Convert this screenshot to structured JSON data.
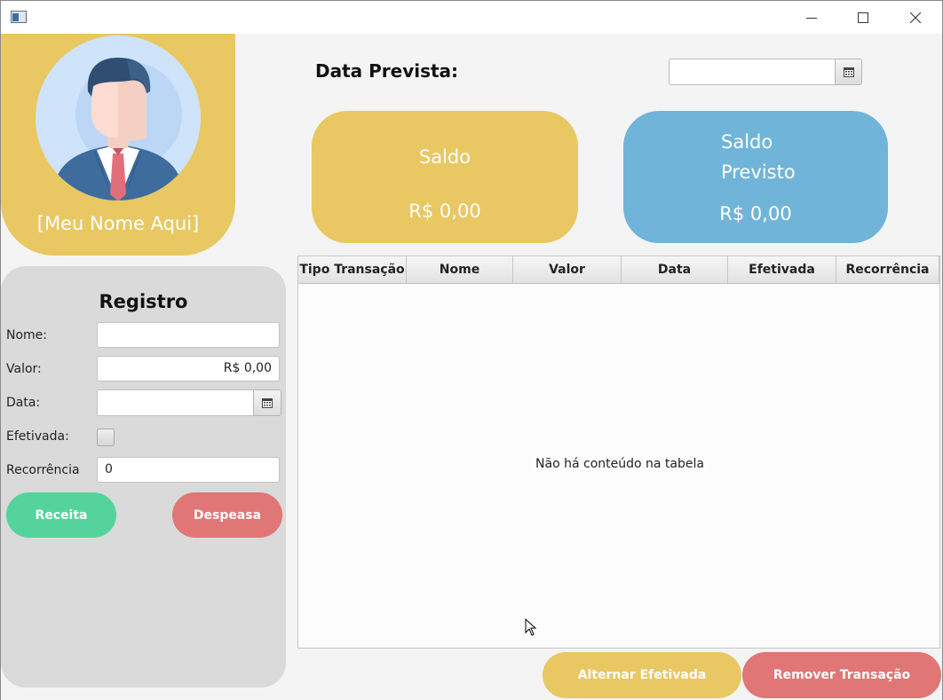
{
  "profile": {
    "name": "[Meu Nome Aqui]"
  },
  "registro": {
    "title": "Registro",
    "nome_label": "Nome:",
    "nome_value": "",
    "valor_label": "Valor:",
    "valor_value": "R$ 0,00",
    "data_label": "Data:",
    "data_value": "",
    "efetivada_label": "Efetivada:",
    "recorrencia_label": "Recorrência",
    "recorrencia_value": "0",
    "receita_label": "Receita",
    "despesa_label": "Despeasa"
  },
  "header": {
    "data_prevista_label": "Data Prevista:",
    "data_prevista_value": ""
  },
  "cards": {
    "saldo_title": "Saldo",
    "saldo_value": "R$ 0,00",
    "previsto_title_line1": "Saldo",
    "previsto_title_line2": "Previsto",
    "previsto_value": "R$ 0,00"
  },
  "table": {
    "columns": [
      "Tipo Transação",
      "Nome",
      "Valor",
      "Data",
      "Efetivada",
      "Recorrência"
    ],
    "empty_message": "Não há conteúdo na tabela"
  },
  "actions": {
    "alternar_label": "Alternar Efetivada",
    "remover_label": "Remover Transação"
  },
  "colors": {
    "yellow": "#e9c762",
    "blue": "#70b5d9",
    "green": "#54d49c",
    "red": "#e07676",
    "panel": "#dadada"
  },
  "icons": [
    "app-icon",
    "minimize-icon",
    "maximize-icon",
    "close-icon",
    "user-avatar",
    "calendar-icon",
    "mouse-cursor-icon"
  ]
}
